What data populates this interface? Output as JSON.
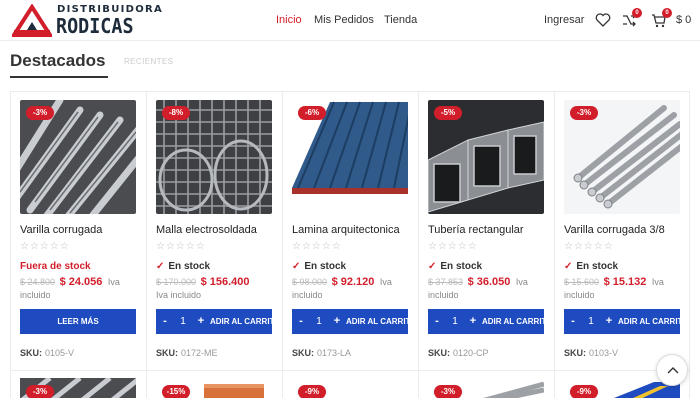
{
  "brand": {
    "top": "DISTRIBUIDORA",
    "name": "RODICAS"
  },
  "nav": {
    "home": "Inicio",
    "orders": "Mis Pedidos",
    "shop": "Tienda"
  },
  "header": {
    "login": "Ingresar",
    "compare_count": "0",
    "cart_count": "0",
    "cart_total": "$ 0"
  },
  "section": {
    "title": "Destacados",
    "tab_recent": "RECIENTES"
  },
  "colors": {
    "accent": "#d21e2b",
    "button": "#1e4bbf"
  },
  "labels": {
    "add_to_cart": "ADIR AL CARRITO",
    "read_more": "LEER MÁS",
    "sku_label": "SKU:",
    "qty": "1",
    "minus": "-",
    "plus": "+"
  },
  "products": [
    {
      "discount": "-3%",
      "name": "Varilla corrugada",
      "stars": "☆☆☆☆☆",
      "stock": "Fuera de stock",
      "old_price": "$ 24.800",
      "price": "$ 24.056",
      "tax_a": "Iva",
      "tax_b": "incluido",
      "sku": "0105-V"
    },
    {
      "discount": "-8%",
      "name": "Malla electrosoldada",
      "stars": "☆☆☆☆☆",
      "stock": "En stock",
      "old_price": "$ 170.000",
      "price": "$ 156.400",
      "tax_a": "",
      "tax_b": "Iva incluido",
      "sku": "0172-ME"
    },
    {
      "discount": "-6%",
      "name": "Lamina arquitectonica",
      "stars": "☆☆☆☆☆",
      "stock": "En stock",
      "old_price": "$ 98.000",
      "price": "$ 92.120",
      "tax_a": "Iva",
      "tax_b": "incluido",
      "sku": "0173-LA"
    },
    {
      "discount": "-5%",
      "name": "Tubería rectangular",
      "stars": "☆☆☆☆☆",
      "stock": "En stock",
      "old_price": "$ 37.853",
      "price": "$ 36.050",
      "tax_a": "Iva",
      "tax_b": "incluido",
      "sku": "0120-CP"
    },
    {
      "discount": "-3%",
      "name": "Varilla corrugada 3/8",
      "stars": "☆☆☆☆☆",
      "stock": "En stock",
      "old_price": "$ 15.600",
      "price": "$ 15.132",
      "tax_a": "Iva",
      "tax_b": "incluido",
      "sku": "0103-V"
    }
  ],
  "row2_discounts": [
    "-3%",
    "-15%",
    "-9%",
    "-3%",
    "-9%"
  ]
}
